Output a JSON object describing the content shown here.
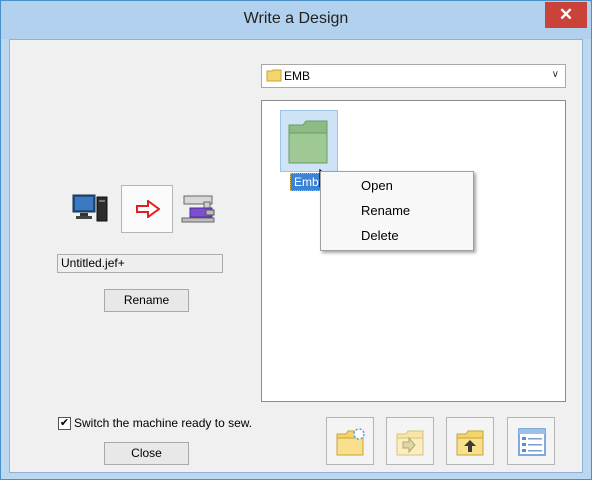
{
  "window": {
    "title": "Write a Design",
    "close_glyph": "✕"
  },
  "folder_select": {
    "value": "EMB",
    "icon": "folder-icon"
  },
  "file_list": {
    "items": [
      {
        "label": "Embf",
        "icon": "folder-icon",
        "selected": true
      }
    ]
  },
  "context_menu": {
    "items": [
      "Open",
      "Rename",
      "Delete"
    ]
  },
  "transfer": {
    "source_icon": "computer-icon",
    "direction_icon": "right-arrow-icon",
    "target_icon": "sewing-machine-usb-icon"
  },
  "filename": {
    "value": "Untitled.jef+"
  },
  "buttons": {
    "rename": "Rename",
    "close": "Close"
  },
  "options": {
    "switch_ready_label": "Switch the machine ready to sew.",
    "switch_ready_checked": true
  },
  "toolbar": {
    "icons": [
      "new-folder-icon",
      "move-folder-icon",
      "parent-folder-icon",
      "details-view-icon"
    ]
  },
  "colors": {
    "accent": "#3a83d6",
    "titlebar": "#b2d1ee",
    "close": "#c9433a",
    "arrow": "#e02020"
  }
}
